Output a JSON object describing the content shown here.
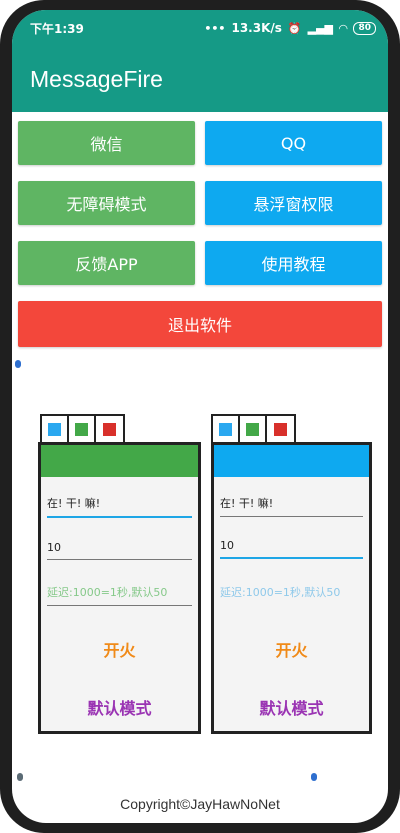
{
  "status": {
    "time": "下午1:39",
    "network_speed": "13.3K/s",
    "battery": "80",
    "icons": [
      "alarm-icon",
      "signal-icon",
      "wifi-icon",
      "battery-icon"
    ]
  },
  "app": {
    "title": "MessageFire"
  },
  "buttons": {
    "wechat": "微信",
    "qq": "QQ",
    "accessibility": "无障碍模式",
    "float_permission": "悬浮窗权限",
    "feedback": "反馈APP",
    "tutorial": "使用教程",
    "exit": "退出软件"
  },
  "colors": {
    "appbar": "#159a86",
    "green_button": "#5fb563",
    "blue_button": "#0ea9f0",
    "exit_button": "#f3473b",
    "fire_text": "#f08a18",
    "mode_text": "#9a34b3"
  },
  "windows": [
    {
      "color": "green",
      "message_value": "在! 干! 嘛!",
      "count_value": "10",
      "delay_placeholder": "延迟:1000=1秒,默认50",
      "fire_label": "开火",
      "mode_label": "默认模式"
    },
    {
      "color": "blue",
      "message_value": "在! 干! 嘛!",
      "count_value": "10",
      "delay_placeholder": "延迟:1000=1秒,默认50",
      "fire_label": "开火",
      "mode_label": "默认模式"
    }
  ],
  "footer": {
    "copyright": "Copyright©JayHawNoNet"
  }
}
